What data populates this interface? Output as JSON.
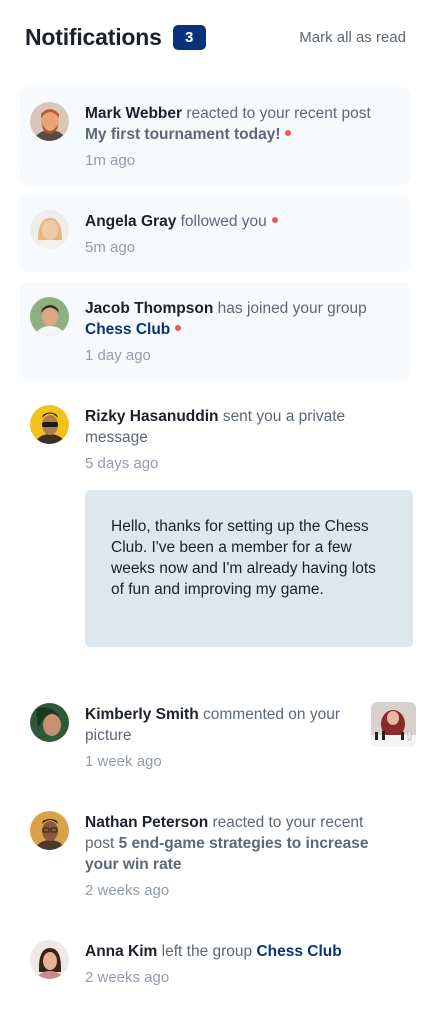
{
  "header": {
    "title": "Notifications",
    "unread_count": "3",
    "mark_all_label": "Mark all as read"
  },
  "notifications": [
    {
      "name": "Mark Webber",
      "action": "reacted to your recent post",
      "target": "My first tournament today!",
      "target_type": "post",
      "time": "1m ago",
      "unread": true
    },
    {
      "name": "Angela Gray",
      "action": "followed you",
      "target": "",
      "time": "5m ago",
      "unread": true
    },
    {
      "name": "Jacob Thompson",
      "action": "has joined your group",
      "target": "Chess Club",
      "target_type": "group",
      "time": "1 day ago",
      "unread": true
    },
    {
      "name": "Rizky Hasanuddin",
      "action": "sent you a private message",
      "target": "",
      "time": "5 days ago",
      "unread": false,
      "message": "Hello, thanks for setting up the Chess Club. I've been a member for a few weeks now and I'm already having lots of fun and improving my game."
    },
    {
      "name": "Kimberly Smith",
      "action": "commented on your picture",
      "target": "",
      "time": "1 week ago",
      "unread": false
    },
    {
      "name": "Nathan Peterson",
      "action": "reacted to your recent post",
      "target": "5 end-game strategies to increase your win rate",
      "target_type": "post",
      "time": "2 weeks ago",
      "unread": false
    },
    {
      "name": "Anna Kim",
      "action": "left the group",
      "target": "Chess Club",
      "target_type": "group",
      "time": "2 weeks ago",
      "unread": false
    }
  ],
  "colors": {
    "primary": "#0a327b",
    "unread_bg": "#f7fafd",
    "dot": "#f65552",
    "message_bg": "#dde7ee",
    "text_dark": "#1c202b",
    "text_muted": "#939cad"
  }
}
